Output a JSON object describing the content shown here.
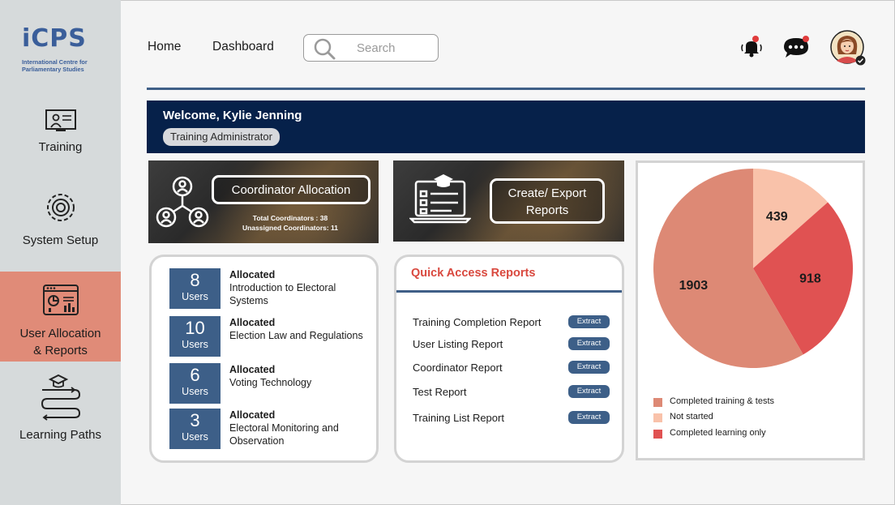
{
  "brand": {
    "logo_text": "iCPS",
    "logo_subtitle_line1": "International Centre for",
    "logo_subtitle_line2": "Parliamentary Studies",
    "accent": "#3a5e9a"
  },
  "sidebar": {
    "items": [
      {
        "label": "Training",
        "icon": "training-icon",
        "active": false
      },
      {
        "label": "System Setup",
        "icon": "settings-gear-icon",
        "active": false
      },
      {
        "label_line1": "User Allocation",
        "label_line2": "& Reports",
        "icon": "report-dashboard-icon",
        "active": true
      },
      {
        "label": "Learning Paths",
        "icon": "learning-paths-icon",
        "active": false
      }
    ],
    "active_color": "#e08b78"
  },
  "header": {
    "nav": [
      "Home",
      "Dashboard"
    ],
    "search_placeholder": "Search",
    "icons": [
      "notification-bell-icon",
      "chat-icon",
      "avatar"
    ]
  },
  "welcome": {
    "greeting": "Welcome, Kylie Jenning",
    "role": "Training Administrator"
  },
  "coordinator_card": {
    "button": "Coordinator Allocation",
    "total": "Total Coordinators : 38",
    "unassigned": "Unassigned Coordinators: 11"
  },
  "export_card": {
    "button_line1": "Create/ Export",
    "button_line2": "Reports"
  },
  "allocations": [
    {
      "count": "8",
      "unit": "Users",
      "status": "Allocated",
      "course": "Introduction to Electoral Systems"
    },
    {
      "count": "10",
      "unit": "Users",
      "status": "Allocated",
      "course": "Election Law and Regulations"
    },
    {
      "count": "6",
      "unit": "Users",
      "status": "Allocated",
      "course": "Voting Technology"
    },
    {
      "count": "3",
      "unit": "Users",
      "status": "Allocated",
      "course": "Electoral Monitoring and Observation"
    }
  ],
  "quick_access": {
    "title": "Quick Access Reports",
    "action_label": "Extract",
    "reports": [
      "Training Completion Report",
      "User Listing Report",
      "Coordinator Report",
      "Test Report",
      "Training List Report"
    ]
  },
  "chart_data": {
    "type": "pie",
    "series": [
      {
        "name": "Completed training & tests",
        "value": 1903,
        "color": "#dd8975"
      },
      {
        "name": "Not started",
        "value": 439,
        "color": "#f9c2aa"
      },
      {
        "name": "Completed learning only",
        "value": 918,
        "color": "#e05252"
      }
    ],
    "legend_position": "bottom"
  }
}
